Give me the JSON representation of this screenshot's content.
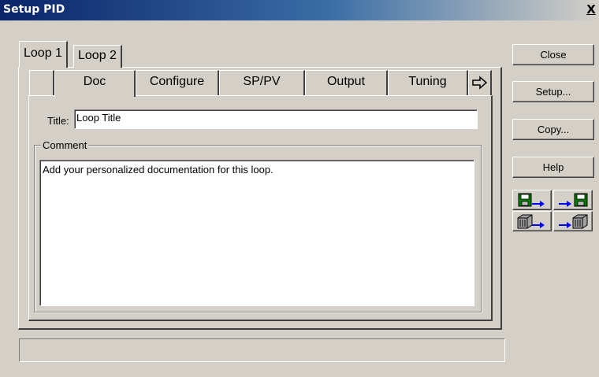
{
  "window": {
    "title": "Setup PID",
    "close_label": "X"
  },
  "loop_tabs": [
    {
      "label": "Loop 1",
      "active": true
    },
    {
      "label": "Loop 2",
      "active": false
    }
  ],
  "tabs": [
    {
      "label": "",
      "active": false
    },
    {
      "label": "Doc",
      "active": true
    },
    {
      "label": "Configure",
      "active": false
    },
    {
      "label": "SP/PV",
      "active": false
    },
    {
      "label": "Output",
      "active": false
    },
    {
      "label": "Tuning",
      "active": false
    }
  ],
  "tab_scroll_icon": "right-arrow-icon",
  "doc": {
    "title_label": "Title:",
    "title_value": "Loop Title",
    "comment_label": "Comment",
    "comment_value": "Add your personalized documentation for this loop."
  },
  "buttons": {
    "close": "Close",
    "setup": "Setup...",
    "copy": "Copy...",
    "help": "Help"
  },
  "icon_buttons": [
    {
      "icon": "save-to-disk-icon"
    },
    {
      "icon": "load-from-disk-icon"
    },
    {
      "icon": "save-to-device-icon"
    },
    {
      "icon": "load-from-device-icon"
    }
  ],
  "status": {
    "text": ""
  }
}
